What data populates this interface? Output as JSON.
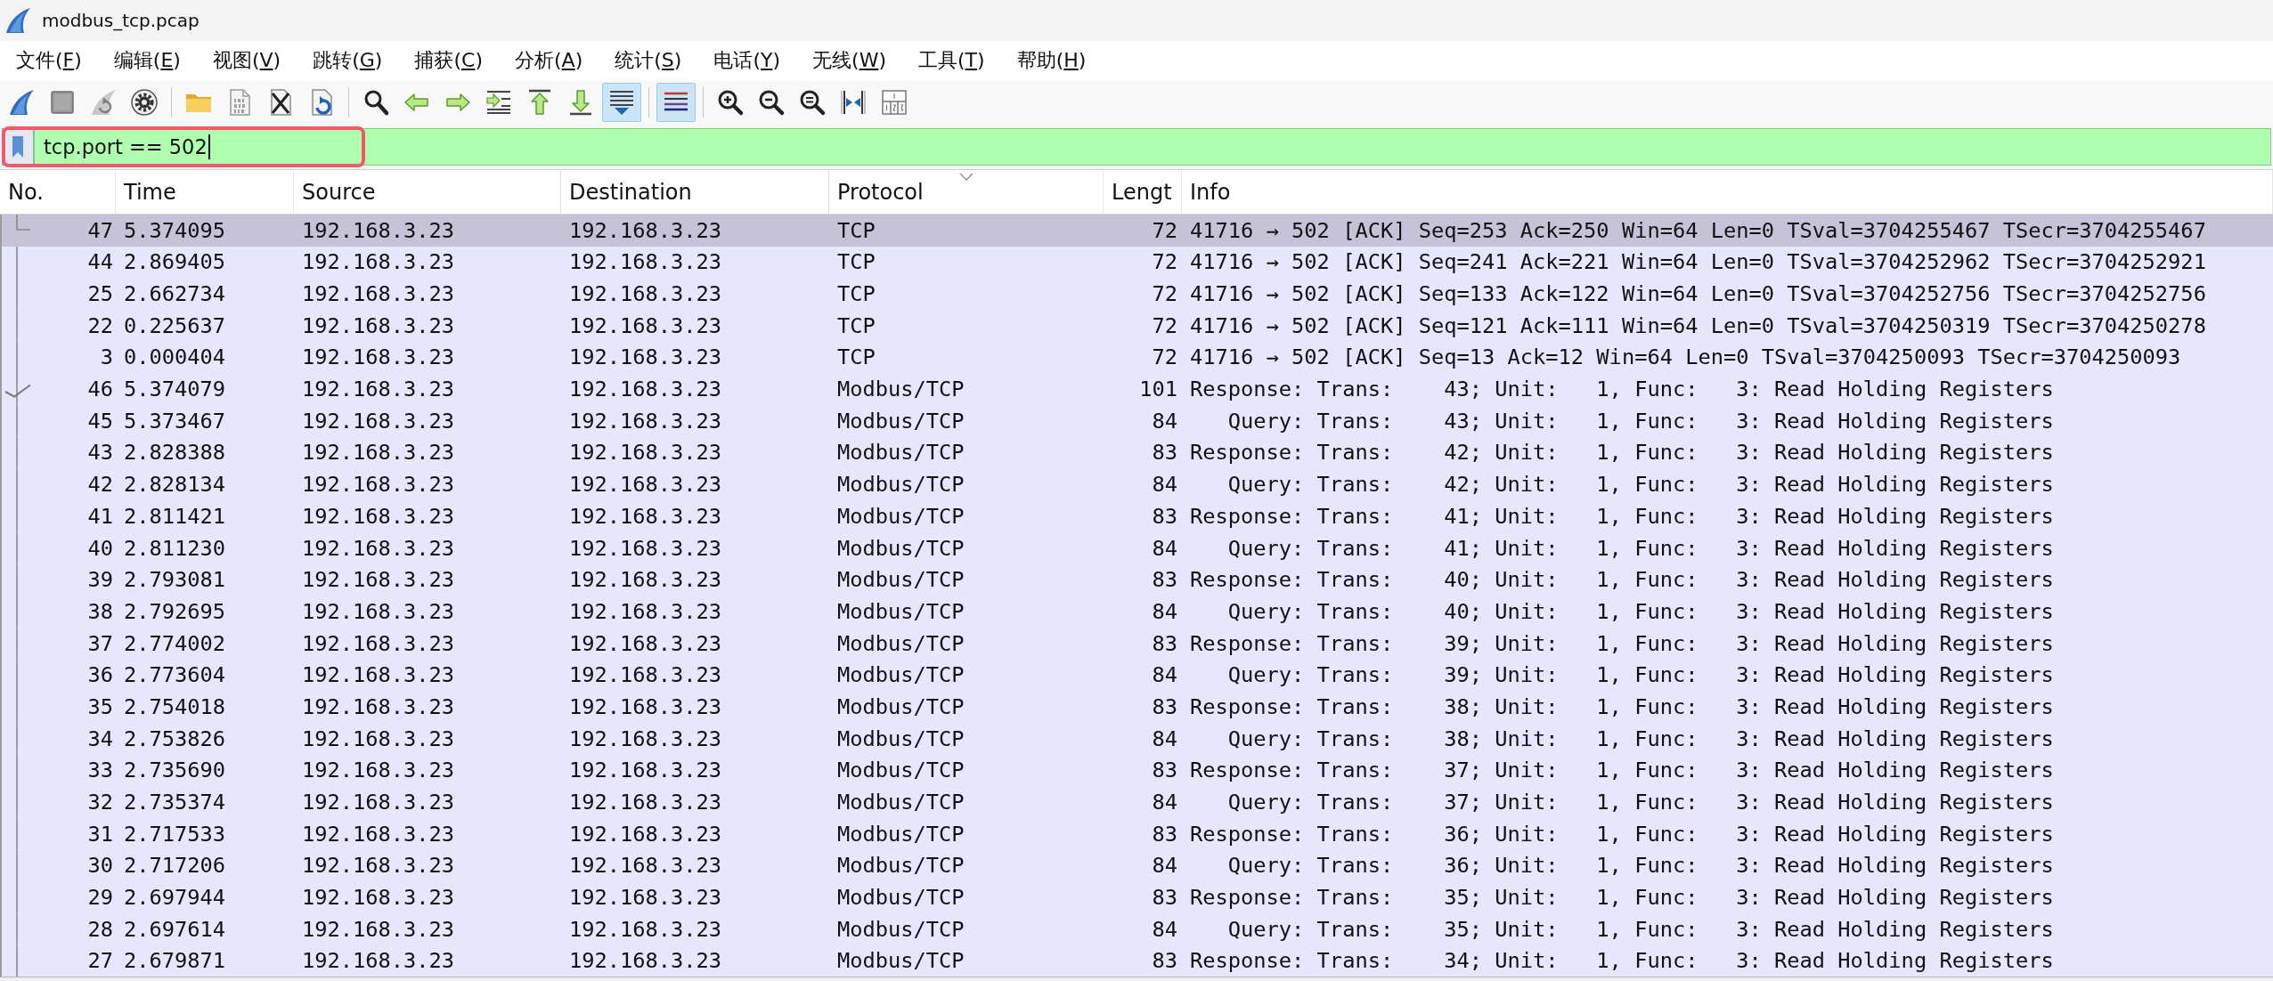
{
  "window": {
    "title": "modbus_tcp.pcap"
  },
  "menu": [
    {
      "text": "文件(",
      "mnemonic": "F",
      "text_after": ")"
    },
    {
      "text": "编辑(",
      "mnemonic": "E",
      "text_after": ")"
    },
    {
      "text": "视图(",
      "mnemonic": "V",
      "text_after": ")"
    },
    {
      "text": "跳转(",
      "mnemonic": "G",
      "text_after": ")"
    },
    {
      "text": "捕获(",
      "mnemonic": "C",
      "text_after": ")"
    },
    {
      "text": "分析(",
      "mnemonic": "A",
      "text_after": ")"
    },
    {
      "text": "统计(",
      "mnemonic": "S",
      "text_after": ")"
    },
    {
      "text": "电话(",
      "mnemonic": "Y",
      "text_after": ")"
    },
    {
      "text": "无线(",
      "mnemonic": "W",
      "text_after": ")"
    },
    {
      "text": "工具(",
      "mnemonic": "T",
      "text_after": ")"
    },
    {
      "text": "帮助(",
      "mnemonic": "H",
      "text_after": ")"
    }
  ],
  "toolbar": [
    {
      "pressed": false
    },
    {
      "pressed": false
    },
    {
      "pressed": false
    },
    {
      "pressed": false
    },
    {
      "pressed": false
    },
    {
      "pressed": false
    },
    {
      "pressed": false
    },
    {
      "pressed": false
    },
    {
      "pressed": false
    },
    {
      "pressed": false
    },
    {
      "pressed": false
    },
    {
      "pressed": false
    },
    {
      "pressed": false
    },
    {
      "pressed": false
    },
    {
      "pressed": true
    },
    {
      "pressed": true
    },
    {
      "pressed": false
    },
    {
      "pressed": false
    },
    {
      "pressed": false
    },
    {
      "pressed": false
    },
    {
      "pressed": false
    }
  ],
  "filter": {
    "text": "tcp.port == 502",
    "outlined": true
  },
  "table": {
    "columns": [
      {
        "label": "No.",
        "sorted": false
      },
      {
        "label": "Time",
        "sorted": false
      },
      {
        "label": "Source",
        "sorted": false
      },
      {
        "label": "Destination",
        "sorted": false
      },
      {
        "label": "Protocol",
        "sorted": true
      },
      {
        "label": "Lengt",
        "sorted": false
      },
      {
        "label": "Info",
        "sorted": false
      }
    ],
    "rows": [
      {
        "no": "47",
        "time": "5.374095",
        "source": "192.168.3.23",
        "destination": "192.168.3.23",
        "protocol": "TCP",
        "length": "72",
        "info": "41716 → 502 [ACK] Seq=253 Ack=250 Win=64 Len=0 TSval=3704255467 TSecr=3704255467",
        "selected": true,
        "acked": false
      },
      {
        "no": "44",
        "time": "2.869405",
        "source": "192.168.3.23",
        "destination": "192.168.3.23",
        "protocol": "TCP",
        "length": "72",
        "info": "41716 → 502 [ACK] Seq=241 Ack=221 Win=64 Len=0 TSval=3704252962 TSecr=3704252921",
        "selected": false,
        "acked": false
      },
      {
        "no": "25",
        "time": "2.662734",
        "source": "192.168.3.23",
        "destination": "192.168.3.23",
        "protocol": "TCP",
        "length": "72",
        "info": "41716 → 502 [ACK] Seq=133 Ack=122 Win=64 Len=0 TSval=3704252756 TSecr=3704252756",
        "selected": false,
        "acked": false
      },
      {
        "no": "22",
        "time": "0.225637",
        "source": "192.168.3.23",
        "destination": "192.168.3.23",
        "protocol": "TCP",
        "length": "72",
        "info": "41716 → 502 [ACK] Seq=121 Ack=111 Win=64 Len=0 TSval=3704250319 TSecr=3704250278",
        "selected": false,
        "acked": false
      },
      {
        "no": "3",
        "time": "0.000404",
        "source": "192.168.3.23",
        "destination": "192.168.3.23",
        "protocol": "TCP",
        "length": "72",
        "info": "41716 → 502 [ACK] Seq=13 Ack=12 Win=64 Len=0 TSval=3704250093 TSecr=3704250093",
        "selected": false,
        "acked": false
      },
      {
        "no": "46",
        "time": "5.374079",
        "source": "192.168.3.23",
        "destination": "192.168.3.23",
        "protocol": "Modbus/TCP",
        "length": "101",
        "info": "Response: Trans:    43; Unit:   1, Func:   3: Read Holding Registers",
        "selected": false,
        "acked": true
      },
      {
        "no": "45",
        "time": "5.373467",
        "source": "192.168.3.23",
        "destination": "192.168.3.23",
        "protocol": "Modbus/TCP",
        "length": "84",
        "info": "   Query: Trans:    43; Unit:   1, Func:   3: Read Holding Registers",
        "selected": false,
        "acked": false
      },
      {
        "no": "43",
        "time": "2.828388",
        "source": "192.168.3.23",
        "destination": "192.168.3.23",
        "protocol": "Modbus/TCP",
        "length": "83",
        "info": "Response: Trans:    42; Unit:   1, Func:   3: Read Holding Registers",
        "selected": false,
        "acked": false
      },
      {
        "no": "42",
        "time": "2.828134",
        "source": "192.168.3.23",
        "destination": "192.168.3.23",
        "protocol": "Modbus/TCP",
        "length": "84",
        "info": "   Query: Trans:    42; Unit:   1, Func:   3: Read Holding Registers",
        "selected": false,
        "acked": false
      },
      {
        "no": "41",
        "time": "2.811421",
        "source": "192.168.3.23",
        "destination": "192.168.3.23",
        "protocol": "Modbus/TCP",
        "length": "83",
        "info": "Response: Trans:    41; Unit:   1, Func:   3: Read Holding Registers",
        "selected": false,
        "acked": false
      },
      {
        "no": "40",
        "time": "2.811230",
        "source": "192.168.3.23",
        "destination": "192.168.3.23",
        "protocol": "Modbus/TCP",
        "length": "84",
        "info": "   Query: Trans:    41; Unit:   1, Func:   3: Read Holding Registers",
        "selected": false,
        "acked": false
      },
      {
        "no": "39",
        "time": "2.793081",
        "source": "192.168.3.23",
        "destination": "192.168.3.23",
        "protocol": "Modbus/TCP",
        "length": "83",
        "info": "Response: Trans:    40; Unit:   1, Func:   3: Read Holding Registers",
        "selected": false,
        "acked": false
      },
      {
        "no": "38",
        "time": "2.792695",
        "source": "192.168.3.23",
        "destination": "192.168.3.23",
        "protocol": "Modbus/TCP",
        "length": "84",
        "info": "   Query: Trans:    40; Unit:   1, Func:   3: Read Holding Registers",
        "selected": false,
        "acked": false
      },
      {
        "no": "37",
        "time": "2.774002",
        "source": "192.168.3.23",
        "destination": "192.168.3.23",
        "protocol": "Modbus/TCP",
        "length": "83",
        "info": "Response: Trans:    39; Unit:   1, Func:   3: Read Holding Registers",
        "selected": false,
        "acked": false
      },
      {
        "no": "36",
        "time": "2.773604",
        "source": "192.168.3.23",
        "destination": "192.168.3.23",
        "protocol": "Modbus/TCP",
        "length": "84",
        "info": "   Query: Trans:    39; Unit:   1, Func:   3: Read Holding Registers",
        "selected": false,
        "acked": false
      },
      {
        "no": "35",
        "time": "2.754018",
        "source": "192.168.3.23",
        "destination": "192.168.3.23",
        "protocol": "Modbus/TCP",
        "length": "83",
        "info": "Response: Trans:    38; Unit:   1, Func:   3: Read Holding Registers",
        "selected": false,
        "acked": false
      },
      {
        "no": "34",
        "time": "2.753826",
        "source": "192.168.3.23",
        "destination": "192.168.3.23",
        "protocol": "Modbus/TCP",
        "length": "84",
        "info": "   Query: Trans:    38; Unit:   1, Func:   3: Read Holding Registers",
        "selected": false,
        "acked": false
      },
      {
        "no": "33",
        "time": "2.735690",
        "source": "192.168.3.23",
        "destination": "192.168.3.23",
        "protocol": "Modbus/TCP",
        "length": "83",
        "info": "Response: Trans:    37; Unit:   1, Func:   3: Read Holding Registers",
        "selected": false,
        "acked": false
      },
      {
        "no": "32",
        "time": "2.735374",
        "source": "192.168.3.23",
        "destination": "192.168.3.23",
        "protocol": "Modbus/TCP",
        "length": "84",
        "info": "   Query: Trans:    37; Unit:   1, Func:   3: Read Holding Registers",
        "selected": false,
        "acked": false
      },
      {
        "no": "31",
        "time": "2.717533",
        "source": "192.168.3.23",
        "destination": "192.168.3.23",
        "protocol": "Modbus/TCP",
        "length": "83",
        "info": "Response: Trans:    36; Unit:   1, Func:   3: Read Holding Registers",
        "selected": false,
        "acked": false
      },
      {
        "no": "30",
        "time": "2.717206",
        "source": "192.168.3.23",
        "destination": "192.168.3.23",
        "protocol": "Modbus/TCP",
        "length": "84",
        "info": "   Query: Trans:    36; Unit:   1, Func:   3: Read Holding Registers",
        "selected": false,
        "acked": false
      },
      {
        "no": "29",
        "time": "2.697944",
        "source": "192.168.3.23",
        "destination": "192.168.3.23",
        "protocol": "Modbus/TCP",
        "length": "83",
        "info": "Response: Trans:    35; Unit:   1, Func:   3: Read Holding Registers",
        "selected": false,
        "acked": false
      },
      {
        "no": "28",
        "time": "2.697614",
        "source": "192.168.3.23",
        "destination": "192.168.3.23",
        "protocol": "Modbus/TCP",
        "length": "84",
        "info": "   Query: Trans:    35; Unit:   1, Func:   3: Read Holding Registers",
        "selected": false,
        "acked": false
      },
      {
        "no": "27",
        "time": "2.679871",
        "source": "192.168.3.23",
        "destination": "192.168.3.23",
        "protocol": "Modbus/TCP",
        "length": "83",
        "info": "Response: Trans:    34; Unit:   1, Func:   3: Read Holding Registers",
        "selected": false,
        "acked": false
      }
    ]
  }
}
